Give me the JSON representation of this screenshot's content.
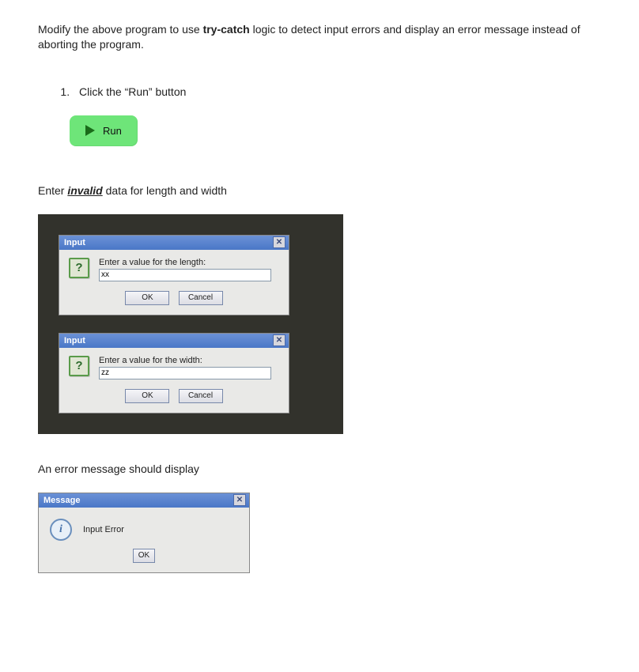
{
  "intro": {
    "pre": "Modify the above program to use ",
    "bold": "try-catch",
    "post": " logic to detect input errors and display an error message instead of aborting the program."
  },
  "step1": "Click the “Run” button",
  "run_label": "Run",
  "enter_invalid": {
    "pre": "Enter ",
    "em": "invalid",
    "post": " data for length and width"
  },
  "dialogs": {
    "length": {
      "title": "Input",
      "prompt": "Enter a value for the length:",
      "value": "xx",
      "ok": "OK",
      "cancel": "Cancel"
    },
    "width": {
      "title": "Input",
      "prompt": "Enter a value for the width:",
      "value": "zz",
      "ok": "OK",
      "cancel": "Cancel"
    }
  },
  "error_intro": "An error message should display",
  "message": {
    "title": "Message",
    "text": "Input Error",
    "ok": "OK"
  },
  "glyphs": {
    "close": "✕",
    "question": "?",
    "info": "i"
  }
}
